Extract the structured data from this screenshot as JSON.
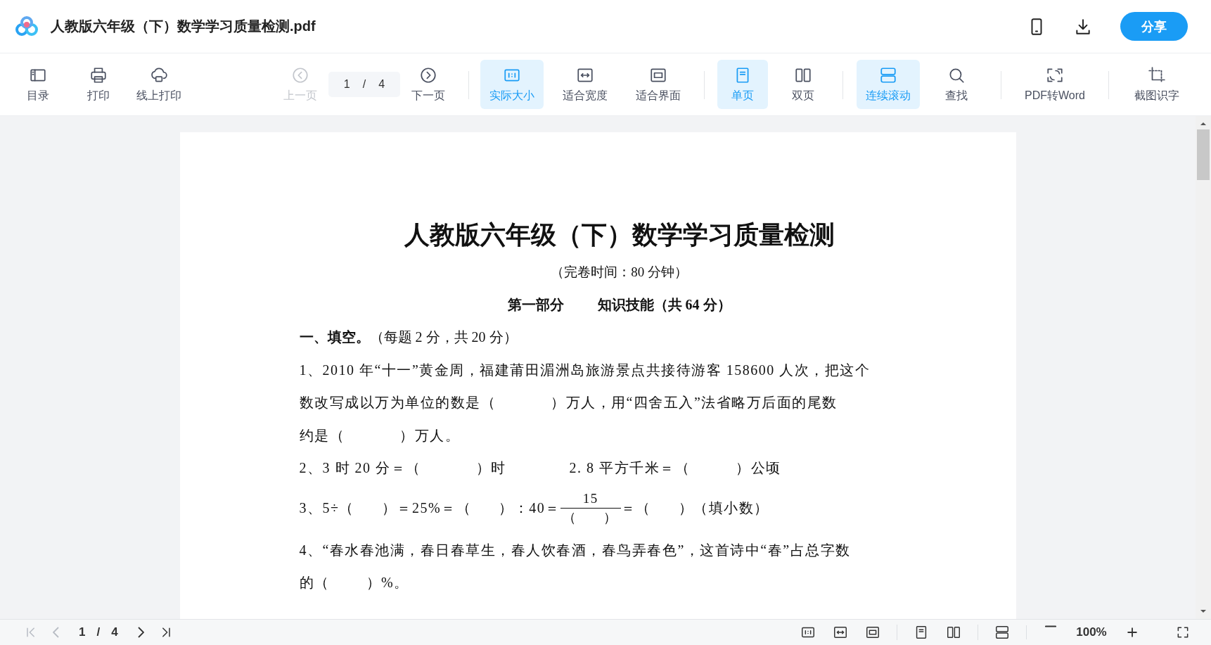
{
  "header": {
    "title": "人教版六年级（下）数学学习质量检测.pdf",
    "share_button": "分享"
  },
  "toolbar": {
    "groups": [
      [
        {
          "kind": "contents",
          "label": "目录",
          "selected": false,
          "disabled": false
        },
        {
          "kind": "print",
          "label": "打印",
          "selected": false,
          "disabled": false
        },
        {
          "kind": "cloudprint",
          "label": "线上打印",
          "selected": false,
          "disabled": false
        }
      ],
      [
        {
          "kind": "prev",
          "label": "上一页",
          "selected": false,
          "disabled": true
        },
        {
          "kind": "pagefield",
          "current": "1",
          "separator": "/",
          "total": "4"
        },
        {
          "kind": "next",
          "label": "下一页",
          "selected": false,
          "disabled": false
        }
      ],
      [
        {
          "kind": "actual",
          "label": "实际大小",
          "selected": true,
          "disabled": false
        },
        {
          "kind": "fitwidth",
          "label": "适合宽度",
          "selected": false,
          "disabled": false
        },
        {
          "kind": "fitpage",
          "label": "适合界面",
          "selected": false,
          "disabled": false
        }
      ],
      [
        {
          "kind": "single",
          "label": "单页",
          "selected": true,
          "disabled": false
        },
        {
          "kind": "double",
          "label": "双页",
          "selected": false,
          "disabled": false
        }
      ],
      [
        {
          "kind": "continuous",
          "label": "连续滚动",
          "selected": true,
          "disabled": false
        },
        {
          "kind": "search",
          "label": "查找",
          "selected": false,
          "disabled": false
        }
      ],
      [
        {
          "kind": "convert",
          "label": "PDF转Word",
          "selected": false,
          "disabled": false
        }
      ],
      [
        {
          "kind": "crop",
          "label": "截图识字",
          "selected": false,
          "disabled": false
        }
      ]
    ]
  },
  "document": {
    "title": "人教版六年级（下）数学学习质量检测",
    "subtitle": "（完卷时间：80 分钟）",
    "section": [
      "第一部分",
      "知识技能（共 64 分）"
    ],
    "heading": "**一、填空。**（每题 2 分，共 20 分）",
    "questions": [
      {
        "kind": "lines",
        "lines": [
          "1、2010 年“十一”黄金周，福建莆田湄洲岛旅游景点共接待游客 158600 人次，把这个",
          "数改写成以万为单位的数是（            ）万人，用“四舍五入”法省略万后面的尾数",
          "约是（            ）万人。"
        ]
      },
      {
        "kind": "pair",
        "parts": [
          "2、3 时 20 分＝（            ）时",
          "2. 8 平方千米＝（          ）公顷"
        ]
      },
      {
        "kind": "fraction",
        "before": "3、5÷（      ）＝25%＝（      ）：40＝",
        "numerator": "15",
        "denominator": "（      ）",
        "after": "＝（      ）（填小数）"
      },
      {
        "kind": "lines",
        "lines": [
          "4、“春水春池满，春日春草生，春人饮春酒，春鸟弄春色”，这首诗中“春”占总字数",
          "的（        ）%。"
        ]
      }
    ]
  },
  "bottom_bar": {
    "nav_before": [
      {
        "kind": "first",
        "disabled": true
      },
      {
        "kind": "prev",
        "disabled": true
      }
    ],
    "page": {
      "current": "1",
      "separator": "/",
      "total": "4"
    },
    "nav_after": [
      {
        "kind": "next",
        "disabled": false
      },
      {
        "kind": "last",
        "disabled": false
      }
    ],
    "view_groups": [
      [
        {
          "kind": "actual"
        },
        {
          "kind": "fitwidth"
        },
        {
          "kind": "fitpage"
        }
      ],
      [
        {
          "kind": "single"
        },
        {
          "kind": "double"
        }
      ],
      [
        {
          "kind": "continuous"
        }
      ]
    ],
    "zoom": "100%"
  }
}
